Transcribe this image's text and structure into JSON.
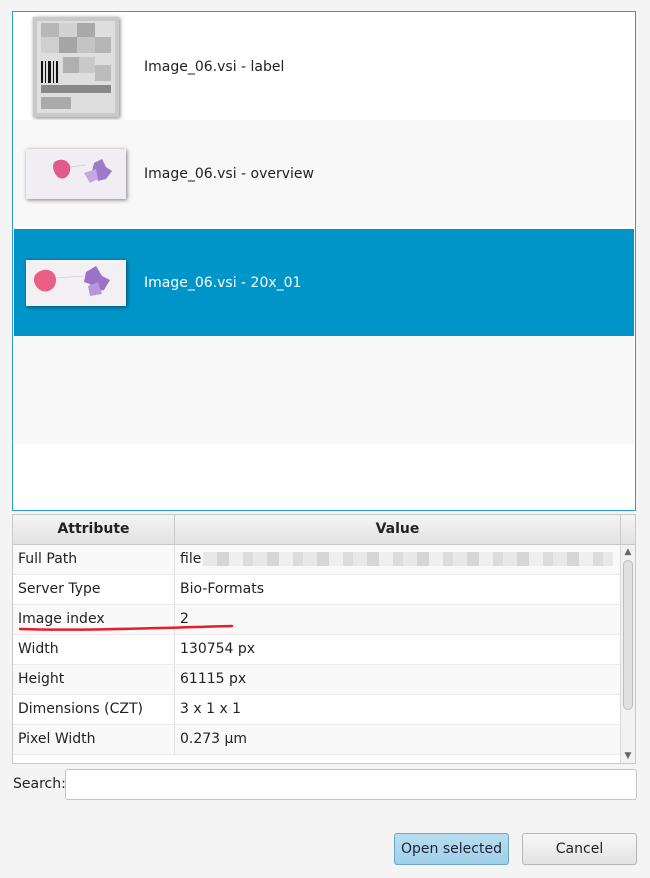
{
  "image_list": {
    "items": [
      {
        "label": "Image_06.vsi - label",
        "thumbnail": "slide-label-thumbnail"
      },
      {
        "label": "Image_06.vsi - overview",
        "thumbnail": "slide-overview-thumbnail"
      },
      {
        "label": "Image_06.vsi - 20x_01",
        "thumbnail": "slide-20x-thumbnail",
        "selected": true
      }
    ],
    "selection_color": "#0095c9"
  },
  "table": {
    "headers": {
      "attribute": "Attribute",
      "value": "Value"
    },
    "rows": [
      {
        "attribute": "Full Path",
        "value": "file"
      },
      {
        "attribute": "Server Type",
        "value": "Bio-Formats"
      },
      {
        "attribute": "Image index",
        "value": "2"
      },
      {
        "attribute": "Width",
        "value": "130754 px"
      },
      {
        "attribute": "Height",
        "value": "61115 px"
      },
      {
        "attribute": "Dimensions (CZT)",
        "value": "3 x 1 x 1"
      },
      {
        "attribute": "Pixel Width",
        "value": "0.273 µm"
      }
    ]
  },
  "search": {
    "label": "Search:",
    "value": ""
  },
  "buttons": {
    "open": "Open selected",
    "cancel": "Cancel"
  },
  "annotation_color": "#e0202a"
}
